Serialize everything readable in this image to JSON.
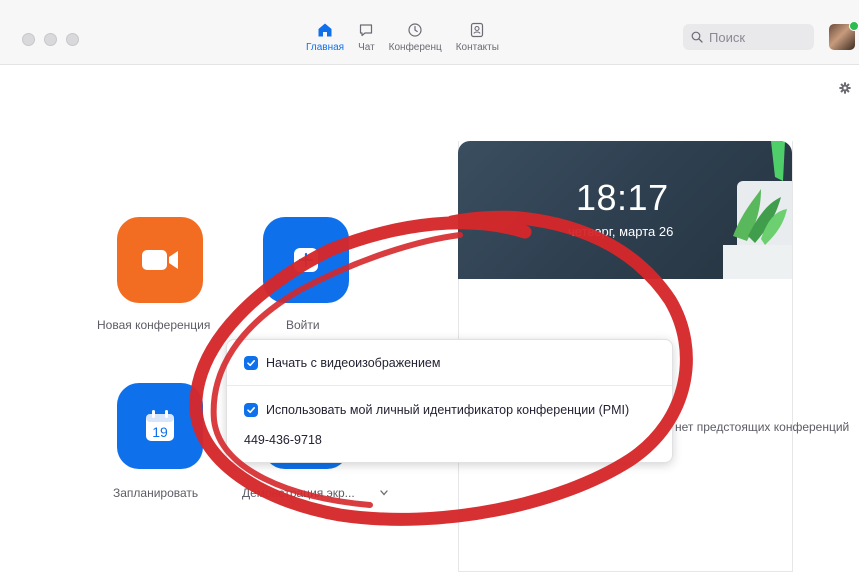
{
  "nav": {
    "home": "Главная",
    "chat": "Чат",
    "meetings": "Конференц",
    "contacts": "Контакты"
  },
  "search": {
    "placeholder": "Поиск"
  },
  "actions": {
    "new_meeting": "Новая конференция",
    "join": "Войти",
    "schedule": "Запланировать",
    "schedule_day": "19",
    "share": "Демонстрация экр..."
  },
  "banner": {
    "time": "18:17",
    "date": "четверг, марта 26"
  },
  "panel": {
    "text": "нет предстоящих конференций"
  },
  "popup": {
    "option_video": "Начать с видеоизображением",
    "option_pmi": "Использовать мой личный идентификатор конференции (PMI)",
    "pmi_number": "449-436-9718"
  },
  "colors": {
    "accent": "#0e71eb",
    "orange": "#f26d21",
    "annotation": "#d5282b",
    "presence": "#2dbd4f"
  }
}
